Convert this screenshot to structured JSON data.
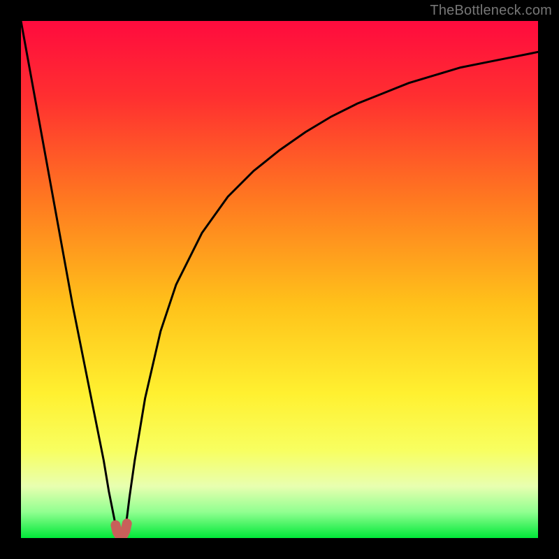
{
  "watermark": "TheBottleneck.com",
  "chart_data": {
    "type": "line",
    "title": "",
    "xlabel": "",
    "ylabel": "",
    "xlim": [
      0,
      100
    ],
    "ylim": [
      0,
      100
    ],
    "series": [
      {
        "name": "bottleneck-curve",
        "x": [
          0,
          2,
          4,
          6,
          8,
          10,
          12,
          14,
          16,
          17,
          18,
          18.5,
          19,
          19.5,
          20,
          20.5,
          21,
          22,
          24,
          27,
          30,
          35,
          40,
          45,
          50,
          55,
          60,
          65,
          70,
          75,
          80,
          85,
          90,
          95,
          100
        ],
        "y": [
          100,
          89,
          78,
          67,
          56,
          45,
          35,
          25,
          15,
          9,
          4,
          1.5,
          0.5,
          0.5,
          1.5,
          4,
          8,
          15,
          27,
          40,
          49,
          59,
          66,
          71,
          75,
          78.5,
          81.5,
          84,
          86,
          88,
          89.5,
          91,
          92,
          93,
          94
        ]
      }
    ],
    "highlight": {
      "name": "minimum-region",
      "x": [
        18.3,
        18.6,
        19,
        19.4,
        19.8,
        20.2,
        20.5
      ],
      "y": [
        2.5,
        1.2,
        0.5,
        0.4,
        0.6,
        1.4,
        2.8
      ],
      "color": "#c8605a"
    },
    "gradient_stops": [
      {
        "offset": 0.0,
        "color": "#ff0b3e"
      },
      {
        "offset": 0.15,
        "color": "#ff3030"
      },
      {
        "offset": 0.35,
        "color": "#ff7a20"
      },
      {
        "offset": 0.55,
        "color": "#ffc21a"
      },
      {
        "offset": 0.72,
        "color": "#fff030"
      },
      {
        "offset": 0.83,
        "color": "#f8ff60"
      },
      {
        "offset": 0.9,
        "color": "#e8ffb0"
      },
      {
        "offset": 0.95,
        "color": "#90ff90"
      },
      {
        "offset": 1.0,
        "color": "#00e838"
      }
    ]
  }
}
